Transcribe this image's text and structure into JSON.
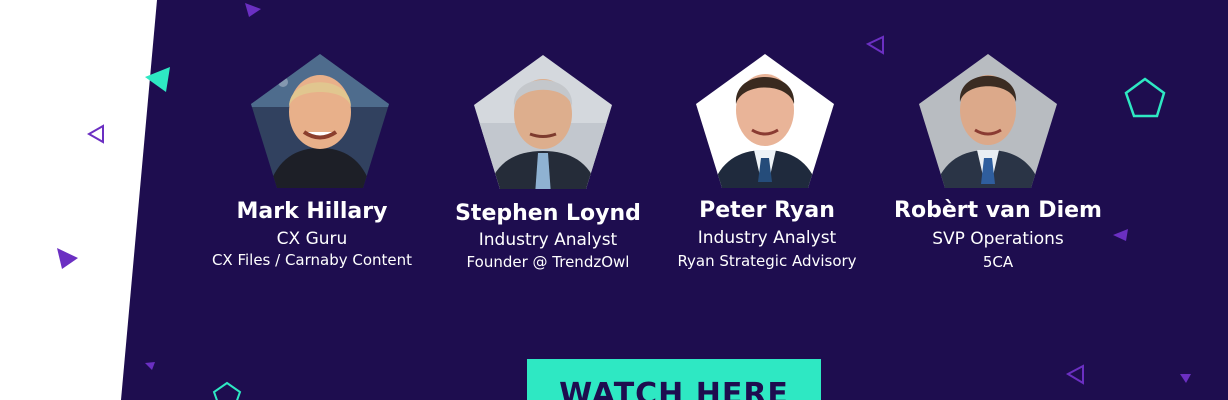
{
  "colors": {
    "background_panel": "#1e0d4f",
    "accent_teal": "#2ee8c3",
    "accent_purple": "#6b2fc2",
    "text_light": "#ffffff"
  },
  "speakers": [
    {
      "name": "Mark Hillary",
      "role": "CX Guru",
      "org": "CX Files / Carnaby Content"
    },
    {
      "name": "Stephen Loynd",
      "role": "Industry Analyst",
      "org": "Founder @ TrendzOwl"
    },
    {
      "name": "Peter Ryan",
      "role": "Industry Analyst",
      "org": "Ryan Strategic Advisory"
    },
    {
      "name": "Robèrt van Diem",
      "role": "SVP Operations",
      "org": "5CA"
    }
  ],
  "cta": {
    "label": "WATCH HERE"
  },
  "icons": {
    "portrait_frame": "pentagon-photo-frame",
    "decoration": "triangle-shapes"
  }
}
